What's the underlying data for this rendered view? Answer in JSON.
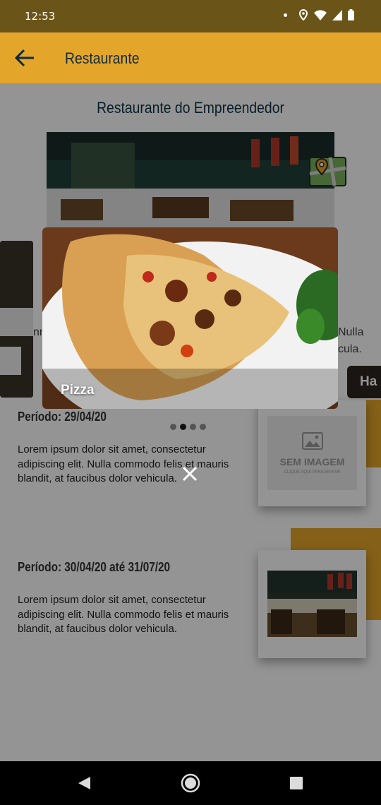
{
  "status_bar": {
    "time": "12:53",
    "icons": [
      "notification-dot-icon",
      "location-icon",
      "wifi-icon",
      "signal-icon",
      "battery-icon"
    ]
  },
  "app_bar": {
    "title": "Restaurante"
  },
  "restaurant": {
    "name": "Restaurante do Empreendedor"
  },
  "background_text": {
    "left": "nn",
    "right_top": "Nulla",
    "right_bottom": "cula."
  },
  "carousel": {
    "current_caption": "Pizza",
    "next_caption": "Ha",
    "page_count": 4,
    "active_index": 1
  },
  "promotions": [
    {
      "period": "Período: 29/04/20",
      "description": "Lorem ipsum dolor sit amet, consectetur adipiscing elit. Nulla commodo felis et mauris blandit, at faucibus dolor vehicula.",
      "image": {
        "title": "SEM IMAGEM",
        "subtitle": "CLIQUE AQUI PARA ENVIAR"
      }
    },
    {
      "period": "Período: 30/04/20 até 31/07/20",
      "description": "Lorem ipsum dolor sit amet, consectetur adipiscing elit. Nulla commodo felis et mauris blandit, at faucibus dolor vehicula."
    }
  ],
  "colors": {
    "accent": "#e4a62a",
    "status_bar": "#6b5417",
    "title_text": "#0f3346"
  }
}
